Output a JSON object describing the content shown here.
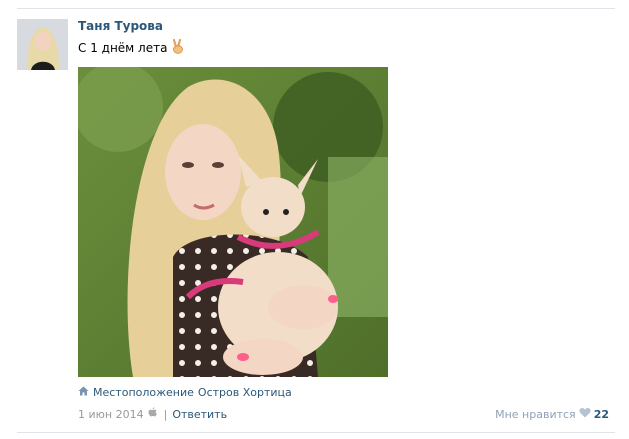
{
  "post": {
    "author": "Таня Турова",
    "status_text": "С 1 днём лета",
    "location_label": "Местоположение",
    "location_name": "Остров Хортица",
    "date": "1 июн 2014",
    "reply_label": "Ответить",
    "likes_label": "Мне нравится",
    "likes_count": "22"
  },
  "icons": {
    "emoji": "victory-hand-icon",
    "location": "home-icon",
    "platform": "apple-icon",
    "like": "heart-icon"
  },
  "colors": {
    "link": "#2b587a",
    "muted": "#999999",
    "separator": "#dfe4ea"
  }
}
